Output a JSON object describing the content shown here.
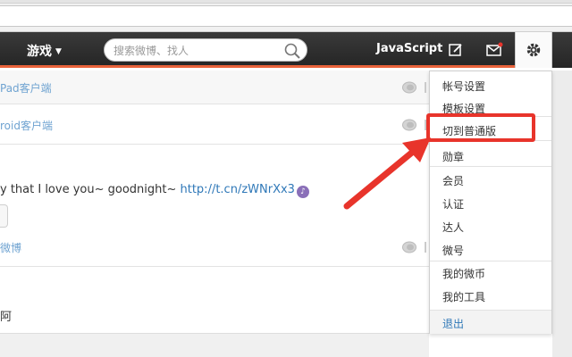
{
  "topbar": {
    "nav_game": "游戏",
    "search_placeholder": "搜索微博、找人",
    "nav_link": "JavaScript"
  },
  "feed": {
    "source_1": "Pad客户端",
    "source_2": "roid客户端",
    "post_text": "y that I love you~ goodnight~ ",
    "post_link": "http://t.cn/zWNrXx3",
    "source_3": "微博",
    "post_tail": "阿"
  },
  "menu": {
    "items": [
      "帐号设置",
      "模板设置",
      "切到普通版",
      "勋章",
      "会员",
      "认证",
      "达人",
      "微号",
      "我的微币",
      "我的工具"
    ],
    "logout": "退出"
  },
  "colors": {
    "accent": "#e8623a",
    "annotation": "#e8342b",
    "link": "#2f78b8",
    "source_link": "#6fa3d1"
  }
}
